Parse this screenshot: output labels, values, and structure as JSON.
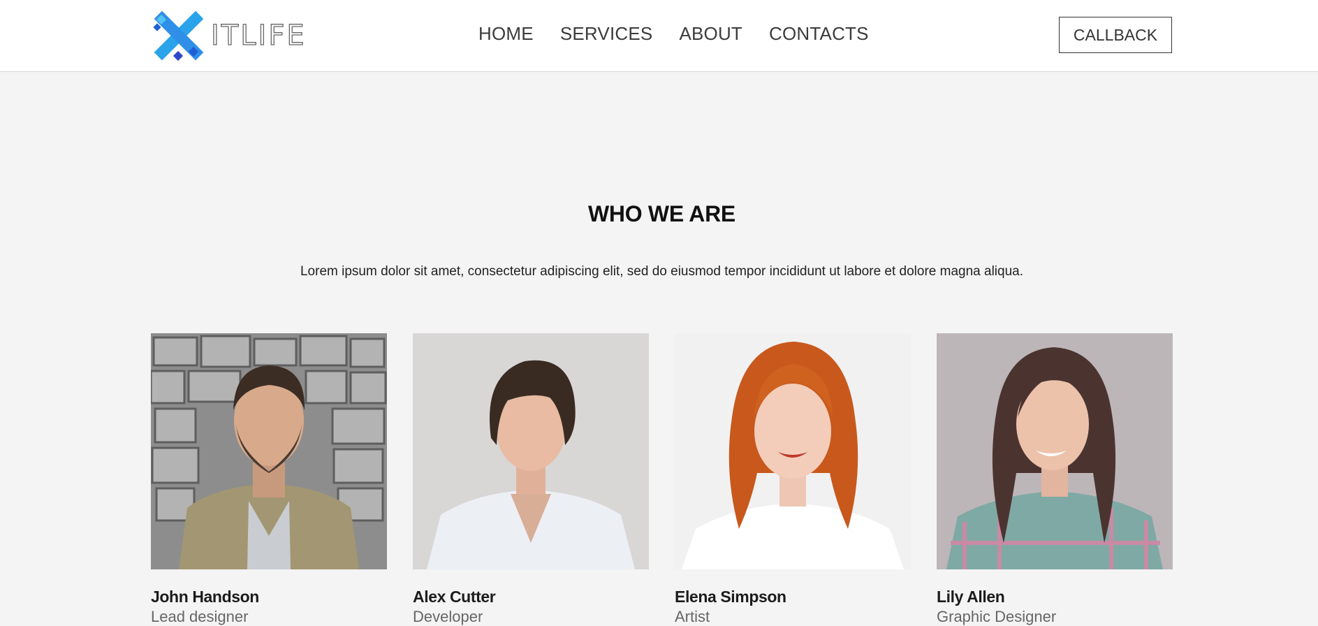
{
  "header": {
    "logo_text": "ITLIFE",
    "nav": [
      "HOME",
      "SERVICES",
      "ABOUT",
      "CONTACTS"
    ],
    "callback_label": "CALLBACK"
  },
  "section": {
    "title": "WHO WE ARE",
    "text": "Lorem ipsum dolor sit amet, consectetur adipiscing elit, sed do eiusmod tempor incididunt ut labore et dolore magna aliqua."
  },
  "team": [
    {
      "name": "John Handson",
      "role": "Lead designer"
    },
    {
      "name": "Alex Cutter",
      "role": "Developer"
    },
    {
      "name": "Elena Simpson",
      "role": "Artist"
    },
    {
      "name": "Lily Allen",
      "role": "Graphic Designer"
    }
  ],
  "colors": {
    "logo_blue": "#29a3ea",
    "logo_dark_blue": "#1f5fd6",
    "background": "#f4f4f4"
  }
}
